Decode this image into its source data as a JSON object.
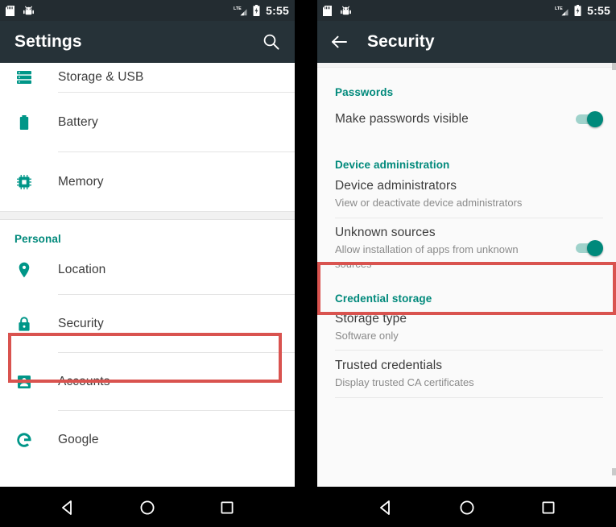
{
  "colors": {
    "toolbar": "#263238",
    "status_bar": "#232c31",
    "accent_teal": "#00897b",
    "highlight_red": "#d9534f",
    "list_bg_left": "#ffffff",
    "list_bg_right": "#fafafa",
    "nav_bar": "#000000",
    "primary_text": "#3c3c3c",
    "secondary_text": "#8a8a8a"
  },
  "left_phone": {
    "status_bar": {
      "clock": "5:55",
      "icons_left": [
        "sd-card-icon",
        "android-bug-icon"
      ],
      "icons_right": [
        "lte-signal-icon",
        "battery-charging-icon"
      ]
    },
    "toolbar": {
      "title": "Settings",
      "action_icon": "search-icon"
    },
    "rows": [
      {
        "label": "Storage & USB",
        "icon": "storage-icon"
      },
      {
        "label": "Battery",
        "icon": "battery-icon"
      },
      {
        "label": "Memory",
        "icon": "memory-icon"
      }
    ],
    "section_personal": "Personal",
    "personal_rows": [
      {
        "label": "Location",
        "icon": "location-pin-icon"
      },
      {
        "label": "Security",
        "icon": "lock-icon",
        "highlighted": true
      },
      {
        "label": "Accounts",
        "icon": "account-icon"
      },
      {
        "label": "Google",
        "icon": "google-g-icon"
      }
    ],
    "nav_bar": [
      "back-triangle-icon",
      "home-circle-icon",
      "recents-square-icon"
    ]
  },
  "right_phone": {
    "status_bar": {
      "clock": "5:55",
      "icons_left": [
        "sd-card-icon",
        "android-bug-icon"
      ],
      "icons_right": [
        "lte-signal-icon",
        "battery-charging-icon"
      ]
    },
    "toolbar": {
      "title": "Security",
      "nav_icon": "back-arrow-icon"
    },
    "sections": [
      {
        "header": "Passwords",
        "items": [
          {
            "title": "Make passwords visible",
            "subtitle": "",
            "toggle": "on"
          }
        ]
      },
      {
        "header": "Device administration",
        "items": [
          {
            "title": "Device administrators",
            "subtitle": "View or deactivate device administrators",
            "toggle": null
          },
          {
            "title": "Unknown sources",
            "subtitle": "Allow installation of apps from unknown sources",
            "toggle": "on",
            "highlighted": true
          }
        ]
      },
      {
        "header": "Credential storage",
        "items": [
          {
            "title": "Storage type",
            "subtitle": "Software only",
            "toggle": null
          },
          {
            "title": "Trusted credentials",
            "subtitle": "Display trusted CA certificates",
            "toggle": null
          }
        ]
      }
    ],
    "nav_bar": [
      "back-triangle-icon",
      "home-circle-icon",
      "recents-square-icon"
    ]
  }
}
